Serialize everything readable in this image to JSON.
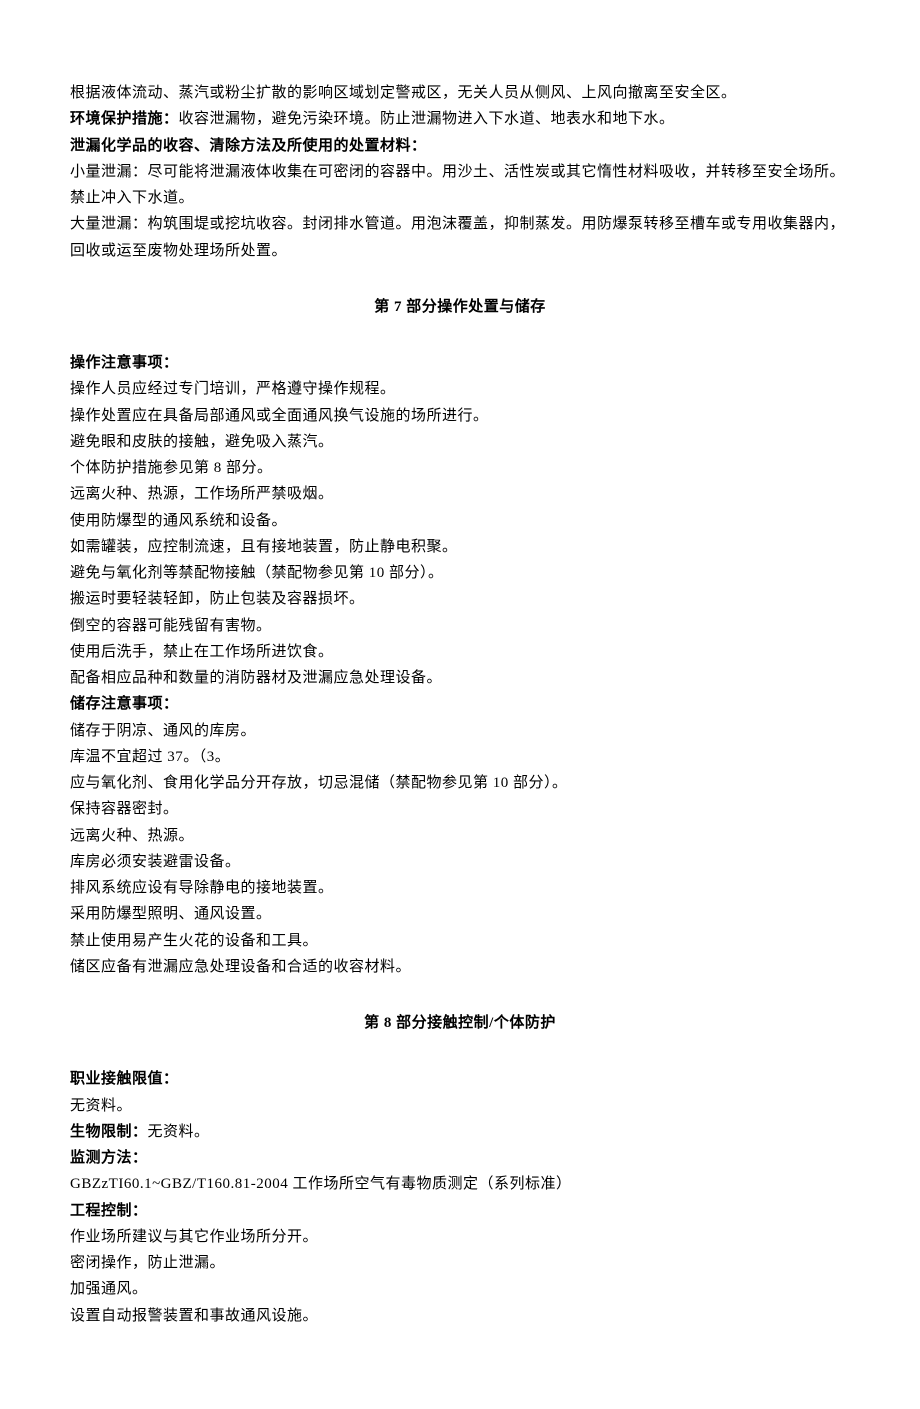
{
  "intro": {
    "line1": "根据液体流动、蒸汽或粉尘扩散的影响区域划定警戒区，无关人员从侧风、上风向撤离至安全区。",
    "env_label": "环境保护措施：",
    "env_text": "收容泄漏物，避免污染环境。防止泄漏物进入下水道、地表水和地下水。",
    "spill_label": "泄漏化学品的收容、清除方法及所使用的处置材料：",
    "small_spill": "小量泄漏：尽可能将泄漏液体收集在可密闭的容器中。用沙土、活性炭或其它惰性材料吸收，并转移至安全场所。禁止冲入下水道。",
    "large_spill": "大量泄漏：构筑围堤或挖坑收容。封闭排水管道。用泡沫覆盖，抑制蒸发。用防爆泵转移至槽车或专用收集器内，回收或运至废物处理场所处置。"
  },
  "section7": {
    "title": "第 7 部分操作处置与储存",
    "op_label": "操作注意事项：",
    "ops": [
      "操作人员应经过专门培训，严格遵守操作规程。",
      "操作处置应在具备局部通风或全面通风换气设施的场所进行。",
      "避免眼和皮肤的接触，避免吸入蒸汽。",
      "个体防护措施参见第 8 部分。",
      "远离火种、热源，工作场所严禁吸烟。",
      "使用防爆型的通风系统和设备。",
      "如需罐装，应控制流速，且有接地装置，防止静电积聚。",
      "避免与氧化剂等禁配物接触（禁配物参见第 10 部分）。",
      "搬运时要轻装轻卸，防止包装及容器损坏。",
      "倒空的容器可能残留有害物。",
      "使用后洗手，禁止在工作场所进饮食。",
      "配备相应品种和数量的消防器材及泄漏应急处理设备。"
    ],
    "store_label": "储存注意事项：",
    "stores": [
      "储存于阴凉、通风的库房。",
      "库温不宜超过 37。（3。",
      "应与氧化剂、食用化学品分开存放，切忌混储（禁配物参见第 10 部分）。",
      "保持容器密封。",
      "远离火种、热源。",
      "库房必须安装避雷设备。",
      "排风系统应设有导除静电的接地装置。",
      "采用防爆型照明、通风设置。",
      "禁止使用易产生火花的设备和工具。",
      "储区应备有泄漏应急处理设备和合适的收容材料。"
    ]
  },
  "section8": {
    "title": "第 8 部分接触控制/个体防护",
    "occ_label": "职业接触限值：",
    "occ_text": "无资料。",
    "bio_label": "生物限制：",
    "bio_text": "无资料。",
    "mon_label": "监测方法：",
    "mon_text": "GBZzTI60.1~GBZ/T160.81-2004 工作场所空气有毒物质测定（系列标准）",
    "eng_label": "工程控制：",
    "engs": [
      "作业场所建议与其它作业场所分开。",
      "密闭操作，防止泄漏。",
      "加强通风。",
      "设置自动报警装置和事故通风设施。"
    ]
  }
}
